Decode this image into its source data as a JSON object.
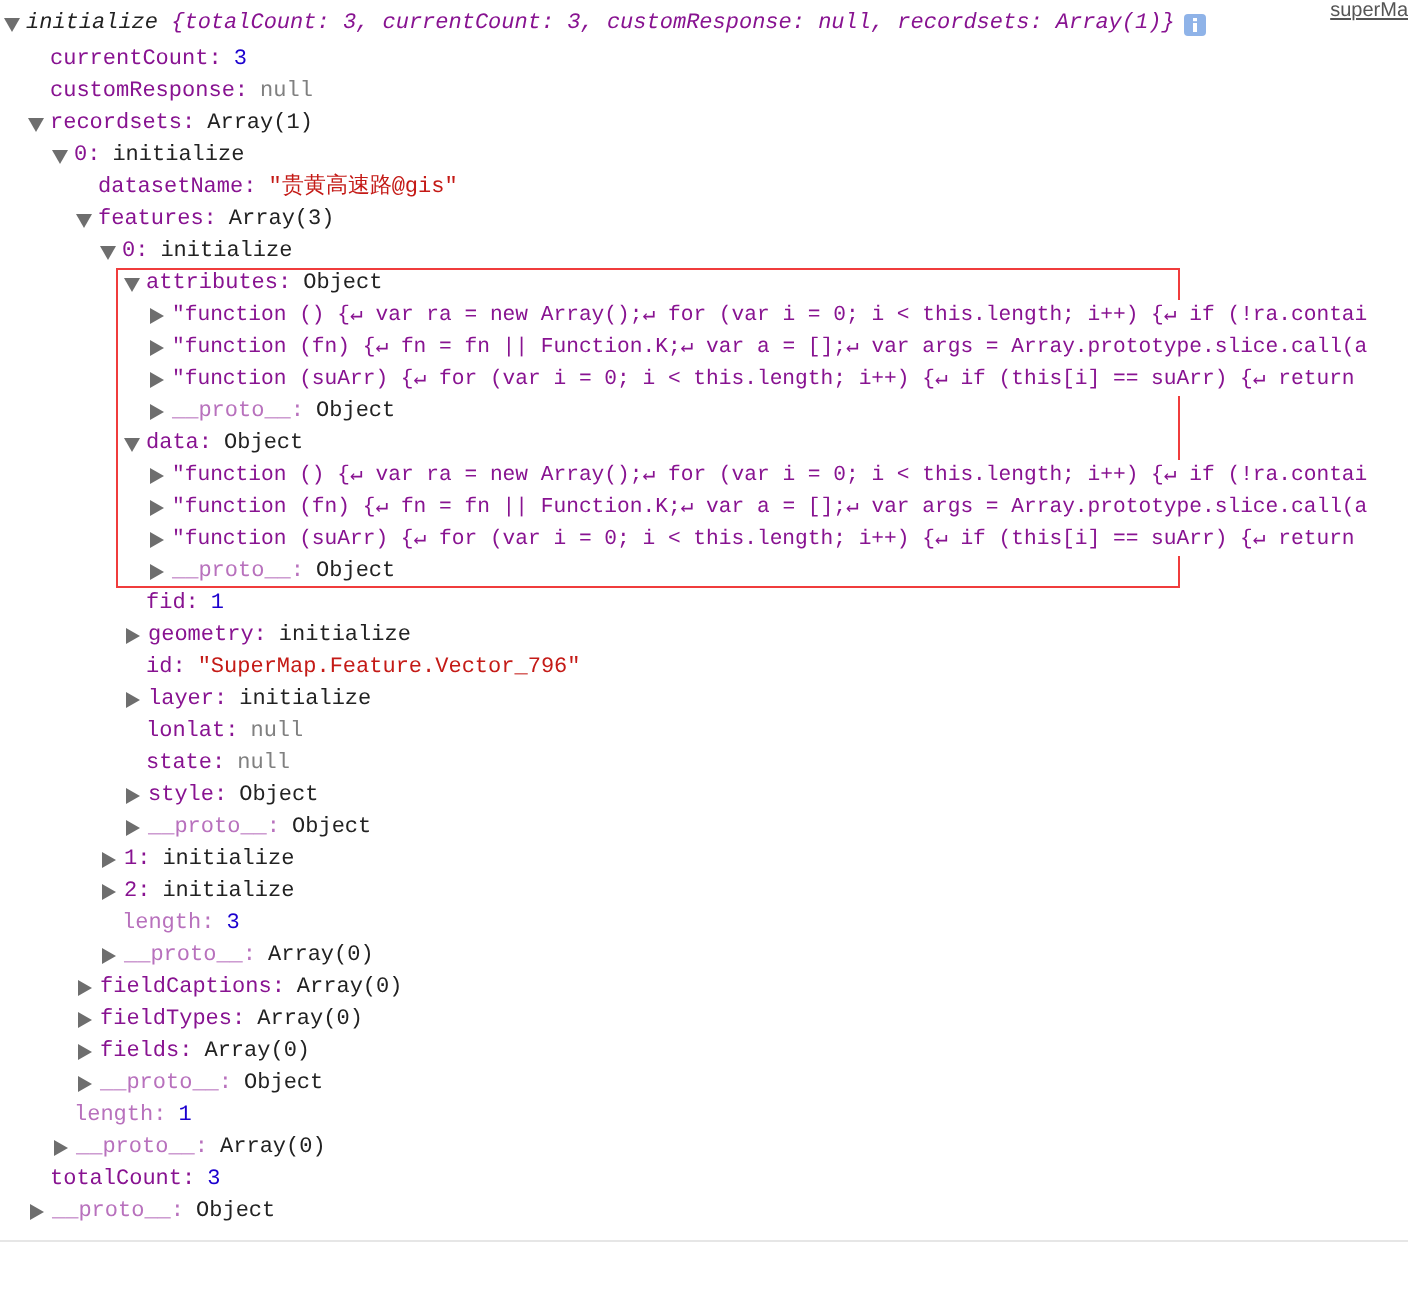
{
  "source_link": "superMa",
  "root": {
    "title": "initialize",
    "preview": "{totalCount: 3, currentCount: 3, customResponse: null, recordsets: Array(1)}",
    "expanded": true,
    "children": [
      {
        "key": "currentCount:",
        "value": "3",
        "kind": "number",
        "dim": false
      },
      {
        "key": "customResponse:",
        "value": "null",
        "kind": "null",
        "dim": false
      },
      {
        "key": "recordsets:",
        "value": "Array(1)",
        "kind": "object",
        "dim": false,
        "expanded": true,
        "children": [
          {
            "key": "0:",
            "value": "initialize",
            "kind": "object",
            "dim": false,
            "expanded": true,
            "children": [
              {
                "key": "datasetName:",
                "value": "\"贵黄高速路@gis\"",
                "kind": "string",
                "dim": false
              },
              {
                "key": "features:",
                "value": "Array(3)",
                "kind": "object",
                "dim": false,
                "expanded": true,
                "children": [
                  {
                    "key": "0:",
                    "value": "initialize",
                    "kind": "object",
                    "dim": false,
                    "expanded": true,
                    "children": [
                      {
                        "key": "attributes:",
                        "value": "Object",
                        "kind": "object",
                        "dim": false,
                        "expanded": true,
                        "highlighted": true,
                        "children": [
                          {
                            "key": "\"function () {↵ var ra = new Array();↵ for (var i = 0; i < this.length; i++) {↵ if (!ra.contai",
                            "kind": "none",
                            "dim": false,
                            "expanded": false
                          },
                          {
                            "key": "\"function (fn) {↵ fn = fn || Function.K;↵ var a = [];↵ var args = Array.prototype.slice.call(a",
                            "kind": "none",
                            "dim": false,
                            "expanded": false
                          },
                          {
                            "key": "\"function (suArr) {↵ for (var i = 0; i < this.length; i++) {↵ if (this[i] == suArr) {↵ return",
                            "kind": "none",
                            "dim": false,
                            "expanded": false
                          },
                          {
                            "key": "__proto__:",
                            "value": "Object",
                            "kind": "object",
                            "dim": true,
                            "expanded": false
                          }
                        ]
                      },
                      {
                        "key": "data:",
                        "value": "Object",
                        "kind": "object",
                        "dim": false,
                        "expanded": true,
                        "highlighted": true,
                        "children": [
                          {
                            "key": "\"function () {↵ var ra = new Array();↵ for (var i = 0; i < this.length; i++) {↵ if (!ra.contai",
                            "kind": "none",
                            "dim": false,
                            "expanded": false
                          },
                          {
                            "key": "\"function (fn) {↵ fn = fn || Function.K;↵ var a = [];↵ var args = Array.prototype.slice.call(a",
                            "kind": "none",
                            "dim": false,
                            "expanded": false
                          },
                          {
                            "key": "\"function (suArr) {↵ for (var i = 0; i < this.length; i++) {↵ if (this[i] == suArr) {↵ return",
                            "kind": "none",
                            "dim": false,
                            "expanded": false
                          },
                          {
                            "key": "__proto__:",
                            "value": "Object",
                            "kind": "object",
                            "dim": true,
                            "expanded": false
                          }
                        ]
                      },
                      {
                        "key": "fid:",
                        "value": "1",
                        "kind": "number",
                        "dim": false,
                        "highlighted": false
                      },
                      {
                        "key": "geometry:",
                        "value": "initialize",
                        "kind": "object",
                        "dim": false,
                        "expanded": false,
                        "highlighted": false
                      },
                      {
                        "key": "id:",
                        "value": "\"SuperMap.Feature.Vector_796\"",
                        "kind": "string",
                        "dim": false,
                        "highlighted": false
                      },
                      {
                        "key": "layer:",
                        "value": "initialize",
                        "kind": "object",
                        "dim": false,
                        "expanded": false,
                        "highlighted": false
                      },
                      {
                        "key": "lonlat:",
                        "value": "null",
                        "kind": "null",
                        "dim": false,
                        "highlighted": false
                      },
                      {
                        "key": "state:",
                        "value": "null",
                        "kind": "null",
                        "dim": false,
                        "highlighted": false
                      },
                      {
                        "key": "style:",
                        "value": "Object",
                        "kind": "object",
                        "dim": false,
                        "expanded": false,
                        "highlighted": false
                      },
                      {
                        "key": "__proto__:",
                        "value": "Object",
                        "kind": "object",
                        "dim": true,
                        "expanded": false,
                        "highlighted": false
                      }
                    ]
                  },
                  {
                    "key": "1:",
                    "value": "initialize",
                    "kind": "object",
                    "dim": false,
                    "expanded": false
                  },
                  {
                    "key": "2:",
                    "value": "initialize",
                    "kind": "object",
                    "dim": false,
                    "expanded": false
                  },
                  {
                    "key": "length:",
                    "value": "3",
                    "kind": "number",
                    "dim": true
                  },
                  {
                    "key": "__proto__:",
                    "value": "Array(0)",
                    "kind": "object",
                    "dim": true,
                    "expanded": false
                  }
                ]
              },
              {
                "key": "fieldCaptions:",
                "value": "Array(0)",
                "kind": "object",
                "dim": false,
                "expanded": false
              },
              {
                "key": "fieldTypes:",
                "value": "Array(0)",
                "kind": "object",
                "dim": false,
                "expanded": false
              },
              {
                "key": "fields:",
                "value": "Array(0)",
                "kind": "object",
                "dim": false,
                "expanded": false
              },
              {
                "key": "__proto__:",
                "value": "Object",
                "kind": "object",
                "dim": true,
                "expanded": false
              }
            ]
          },
          {
            "key": "length:",
            "value": "1",
            "kind": "number",
            "dim": true
          },
          {
            "key": "__proto__:",
            "value": "Array(0)",
            "kind": "object",
            "dim": true,
            "expanded": false
          }
        ]
      },
      {
        "key": "totalCount:",
        "value": "3",
        "kind": "number",
        "dim": false
      },
      {
        "key": "__proto__:",
        "value": "Object",
        "kind": "object",
        "dim": true,
        "expanded": false
      }
    ]
  }
}
